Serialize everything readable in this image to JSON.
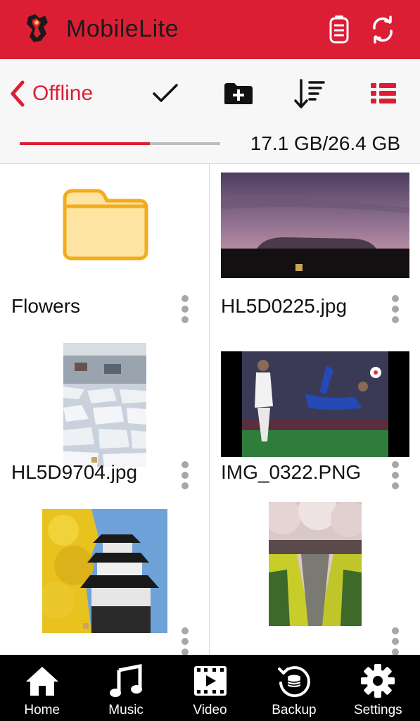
{
  "header": {
    "title": "MobileLite",
    "logo_icon": "kingston-logo-icon",
    "storage_icon": "drive-storage-icon",
    "sync_icon": "sync-icon",
    "brand_color": "#dc1e35"
  },
  "toolbar": {
    "back_label": "Offline",
    "select_icon": "checkmark-icon",
    "new_folder_icon": "new-folder-icon",
    "sort_icon": "sort-icon",
    "view_icon": "list-view-icon"
  },
  "storage": {
    "used_text": "17.1 GB/26.4 GB",
    "used_fraction": 0.648
  },
  "files": [
    {
      "name": "Flowers",
      "kind": "folder"
    },
    {
      "name": "HL5D0225.jpg",
      "kind": "image"
    },
    {
      "name": "HL5D9704.jpg",
      "kind": "image"
    },
    {
      "name": "IMG_0322.PNG",
      "kind": "image"
    },
    {
      "name": "",
      "kind": "image"
    },
    {
      "name": "",
      "kind": "image"
    }
  ],
  "bottom_nav": [
    {
      "label": "Home",
      "icon": "home-icon"
    },
    {
      "label": "Music",
      "icon": "music-icon"
    },
    {
      "label": "Video",
      "icon": "video-icon"
    },
    {
      "label": "Backup",
      "icon": "backup-icon"
    },
    {
      "label": "Settings",
      "icon": "settings-icon"
    }
  ]
}
